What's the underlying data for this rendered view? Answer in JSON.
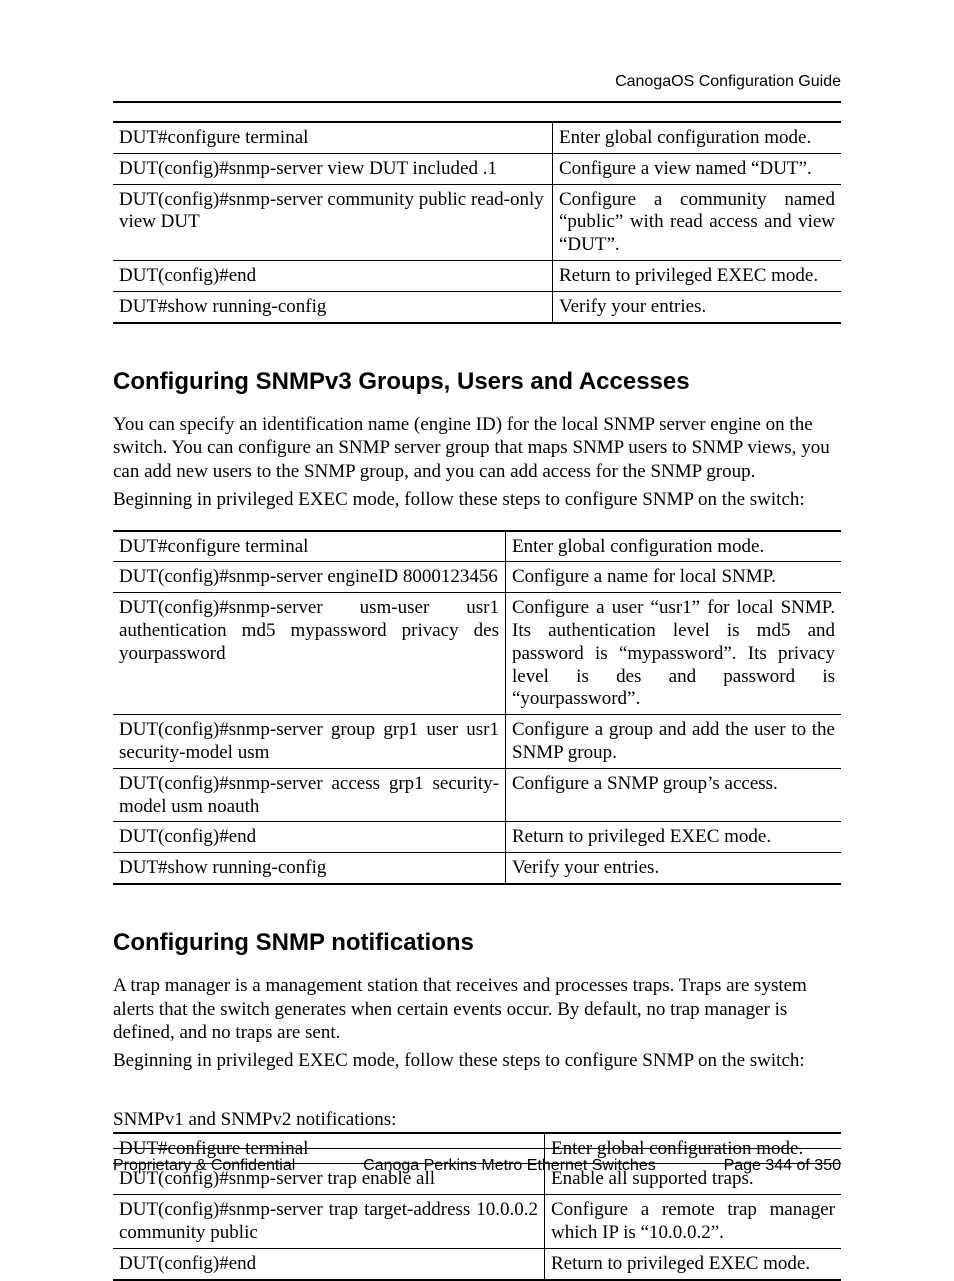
{
  "header": {
    "title": "CanogaOS Configuration Guide"
  },
  "table1": {
    "rows": [
      {
        "cmd": "DUT#configure terminal",
        "desc": "Enter global configuration mode."
      },
      {
        "cmd": "DUT(config)#snmp-server view DUT included .1",
        "desc": "Configure a view named “DUT”."
      },
      {
        "cmd": "DUT(config)#snmp-server community public read-only view DUT",
        "desc": "Configure a community named “public” with read access and view “DUT”."
      },
      {
        "cmd": "DUT(config)#end",
        "desc": "Return to privileged EXEC mode."
      },
      {
        "cmd": "DUT#show running-config",
        "desc": "Verify your entries."
      }
    ]
  },
  "section1": {
    "heading": "Configuring SNMPv3 Groups, Users and Accesses",
    "p1": "You can specify an identification name (engine ID) for the local SNMP server engine on the switch. You can configure an SNMP server group that maps SNMP users to SNMP views, you can add new users to the SNMP group, and you can add access for the SNMP group.",
    "p2": "Beginning in privileged EXEC mode, follow these steps to configure SNMP on the switch:"
  },
  "table2": {
    "rows": [
      {
        "cmd": "DUT#configure terminal",
        "desc": "Enter global configuration mode."
      },
      {
        "cmd": "DUT(config)#snmp-server engineID 8000123456",
        "desc": "Configure a name for local SNMP."
      },
      {
        "cmd": "DUT(config)#snmp-server usm-user usr1 authentication md5 mypassword privacy des yourpassword",
        "desc": "Configure a user “usr1” for local SNMP. Its authentication level is md5 and password is “mypassword”. Its privacy level is des and password is “yourpassword”."
      },
      {
        "cmd": "DUT(config)#snmp-server group grp1 user usr1 security-model usm",
        "desc": "Configure a group and add the user to the SNMP group."
      },
      {
        "cmd": "DUT(config)#snmp-server access grp1 security-model usm noauth",
        "desc": "Configure a SNMP group’s access."
      },
      {
        "cmd": "DUT(config)#end",
        "desc": "Return to privileged EXEC mode."
      },
      {
        "cmd": "DUT#show running-config",
        "desc": "Verify your entries."
      }
    ]
  },
  "section2": {
    "heading": "Configuring SNMP notifications",
    "p1": "A trap manager is a management station that receives and processes traps. Traps are system alerts that the switch generates when certain events occur. By default, no trap manager is defined, and no traps are sent.",
    "p2": "Beginning in privileged EXEC mode, follow these steps to configure SNMP on the switch:",
    "caption": "SNMPv1 and SNMPv2 notifications:"
  },
  "table3": {
    "rows": [
      {
        "cmd": "DUT#configure terminal",
        "desc": "Enter global configuration mode."
      },
      {
        "cmd": "DUT(config)#snmp-server trap enable all",
        "desc": "Enable all supported traps."
      },
      {
        "cmd": "DUT(config)#snmp-server trap target-address 10.0.0.2 community public",
        "desc": "Configure a remote trap manager which IP is “10.0.0.2”."
      },
      {
        "cmd": "DUT(config)#end",
        "desc": "Return to privileged EXEC mode."
      }
    ]
  },
  "footer": {
    "left": "Proprietary & Confidential",
    "center": "Canoga Perkins Metro Ethernet Switches",
    "right": "Page 344 of 350"
  }
}
